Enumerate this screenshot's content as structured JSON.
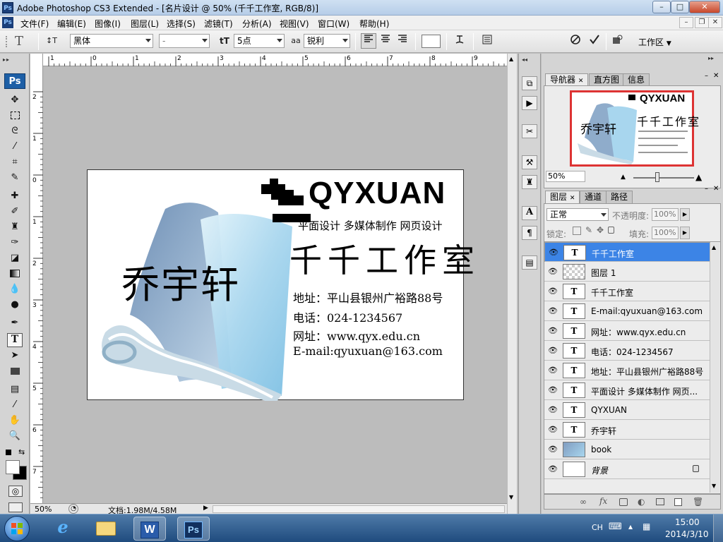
{
  "window": {
    "title": "Adobe Photoshop CS3 Extended - [名片设计 @ 50% (千千工作室, RGB/8)]",
    "app_icon": "Ps",
    "minimize": "–",
    "maximize": "□",
    "close": "✕"
  },
  "menu": {
    "items": [
      "文件(F)",
      "编辑(E)",
      "图像(I)",
      "图层(L)",
      "选择(S)",
      "滤镜(T)",
      "分析(A)",
      "视图(V)",
      "窗口(W)",
      "帮助(H)"
    ],
    "doc_minimize": "–",
    "doc_restore": "❐",
    "doc_close": "✕"
  },
  "options": {
    "tool_glyph": "T",
    "orient_glyph": "↕T",
    "font_family": "黑体",
    "font_style": "-",
    "font_size_glyph": "tT",
    "font_size": "5点",
    "aa_glyph": "aa",
    "antialias": "锐利",
    "workspace": "工作区"
  },
  "toolbox": {
    "logo": "Ps"
  },
  "status": {
    "zoom": "50%",
    "doc_info": "文档:1.98M/4.58M"
  },
  "ruler": {
    "h_labels": [
      "1",
      "0",
      "1",
      "2",
      "3",
      "4",
      "5",
      "6",
      "7",
      "8",
      "9",
      "10"
    ],
    "v_labels": [
      "2",
      "1",
      "0",
      "1",
      "2",
      "3",
      "4",
      "5",
      "6",
      "7"
    ]
  },
  "card": {
    "logo_text": "QYXUAN",
    "services": "平面设计 多媒体制作 网页设计",
    "studio": "千千工作室",
    "person": "乔宇轩",
    "address": "地址：平山县银州广裕路88号",
    "phone": "电话：024-1234567",
    "website": "网址：www.qyx.edu.cn",
    "email": "E-mail:qyuxuan@163.com"
  },
  "navigator": {
    "tabs": [
      "导航器",
      "直方图",
      "信息"
    ],
    "zoom": "50%",
    "preview_logo": "QYXUAN",
    "preview_person": "乔宇轩",
    "preview_studio": "千千工作室"
  },
  "layers": {
    "tabs": [
      "图层",
      "通道",
      "路径"
    ],
    "blend_mode": "正常",
    "opacity_label": "不透明度:",
    "opacity": "100%",
    "lock_label": "锁定:",
    "fill_label": "填充:",
    "fill": "100%",
    "rows": [
      {
        "name": "千千工作室",
        "kind": "T",
        "selected": true
      },
      {
        "name": "图层 1",
        "kind": "checker",
        "selected": false
      },
      {
        "name": "千千工作室",
        "kind": "T",
        "selected": false
      },
      {
        "name": "E-mail:qyuxuan@163.com",
        "kind": "T",
        "selected": false
      },
      {
        "name": "网址：www.qyx.edu.cn",
        "kind": "T",
        "selected": false
      },
      {
        "name": "电话：024-1234567",
        "kind": "T",
        "selected": false
      },
      {
        "name": "地址：平山县银州广裕路88号",
        "kind": "T",
        "selected": false
      },
      {
        "name": "平面设计 多媒体制作 网页...",
        "kind": "T",
        "selected": false
      },
      {
        "name": "QYXUAN",
        "kind": "T",
        "selected": false
      },
      {
        "name": "乔宇轩",
        "kind": "T",
        "selected": false
      },
      {
        "name": "book",
        "kind": "book",
        "selected": false
      },
      {
        "name": "背景",
        "kind": "bg",
        "selected": false
      }
    ]
  },
  "taskbar": {
    "lang": "CH",
    "time": "15:00",
    "date": "2014/3/10"
  },
  "colors": {
    "selection": "#3c84e6",
    "ps_blue": "#1d5fa6",
    "book_blue": "#a8d6ee"
  }
}
